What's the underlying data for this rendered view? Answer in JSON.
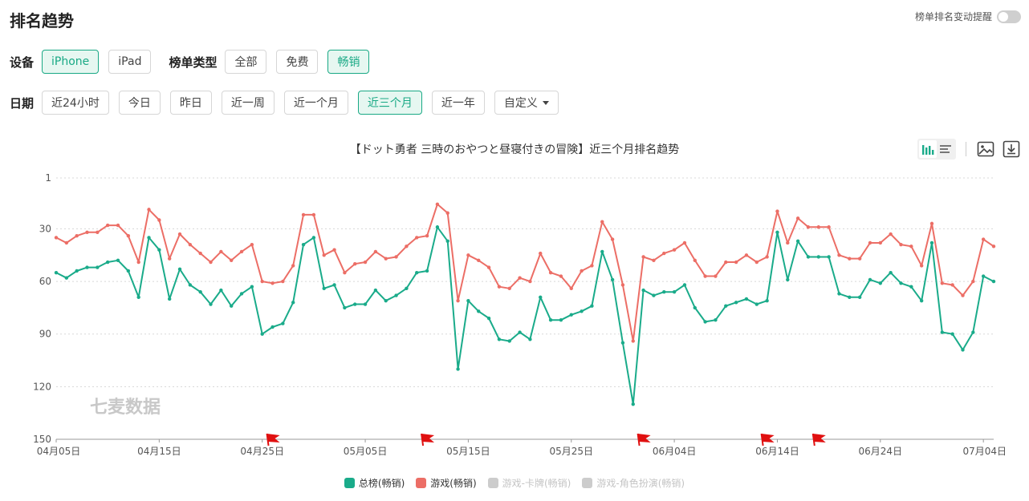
{
  "header": {
    "title": "排名趋势",
    "toggle_label": "榜单排名变动提醒"
  },
  "filters": {
    "device_label": "设备",
    "devices": [
      {
        "label": "iPhone",
        "active": true
      },
      {
        "label": "iPad",
        "active": false
      }
    ],
    "list_type_label": "榜单类型",
    "list_types": [
      {
        "label": "全部",
        "active": false
      },
      {
        "label": "免费",
        "active": false
      },
      {
        "label": "畅销",
        "active": true
      }
    ],
    "date_label": "日期",
    "dates": [
      {
        "label": "近24小时",
        "active": false
      },
      {
        "label": "今日",
        "active": false
      },
      {
        "label": "昨日",
        "active": false
      },
      {
        "label": "近一周",
        "active": false
      },
      {
        "label": "近一个月",
        "active": false
      },
      {
        "label": "近三个月",
        "active": true
      },
      {
        "label": "近一年",
        "active": false
      },
      {
        "label": "自定义",
        "active": false,
        "dropdown": true
      }
    ]
  },
  "colors": {
    "accent": "#19a985",
    "series_green": "#1aab8a",
    "series_red": "#ec6e66",
    "series_disabled": "#cccccc",
    "flag": "#e01010"
  },
  "chart_data": {
    "type": "line",
    "title": "【ドット勇者 三時のおやつと昼寝付きの冒険】近三个月排名趋势",
    "x_start": "2025-04-05",
    "x_ticks": [
      "04月05日",
      "04月15日",
      "04月25日",
      "05月05日",
      "05月15日",
      "05月25日",
      "06月04日",
      "06月14日",
      "06月24日",
      "07月04日"
    ],
    "y_ticks": [
      1,
      30,
      60,
      90,
      120,
      150
    ],
    "ylim": [
      1,
      150
    ],
    "y_inverted": true,
    "grid": true,
    "watermark": "七麦数据",
    "flag_days": [
      21,
      36,
      57,
      69,
      74
    ],
    "legend_position": "bottom",
    "series": [
      {
        "name": "总榜(畅销)",
        "color": "#1aab8a",
        "enabled": true,
        "values": [
          55,
          58,
          54,
          52,
          52,
          49,
          48,
          54,
          69,
          35,
          42,
          70,
          53,
          62,
          66,
          73,
          65,
          74,
          67,
          63,
          90,
          86,
          84,
          72,
          39,
          35,
          64,
          62,
          75,
          73,
          73,
          65,
          71,
          68,
          64,
          55,
          54,
          29,
          37,
          110,
          71,
          77,
          81,
          93,
          94,
          89,
          93,
          69,
          82,
          82,
          79,
          77,
          74,
          43,
          59,
          95,
          130,
          65,
          68,
          66,
          66,
          62,
          75,
          83,
          82,
          74,
          72,
          70,
          73,
          71,
          32,
          59,
          37,
          46,
          46,
          46,
          67,
          69,
          69,
          59,
          61,
          55,
          61,
          63,
          71,
          38,
          89,
          90,
          99,
          89,
          57,
          60
        ]
      },
      {
        "name": "游戏(畅销)",
        "color": "#ec6e66",
        "enabled": true,
        "values": [
          35,
          38,
          34,
          32,
          32,
          28,
          28,
          34,
          49,
          19,
          25,
          47,
          33,
          39,
          44,
          49,
          43,
          48,
          43,
          39,
          60,
          61,
          60,
          51,
          22,
          22,
          45,
          42,
          55,
          50,
          49,
          43,
          47,
          46,
          40,
          35,
          34,
          16,
          21,
          71,
          45,
          48,
          52,
          63,
          64,
          58,
          60,
          44,
          55,
          57,
          64,
          54,
          51,
          26,
          36,
          62,
          94,
          46,
          48,
          44,
          42,
          38,
          48,
          57,
          57,
          49,
          49,
          45,
          49,
          46,
          20,
          38,
          24,
          29,
          29,
          29,
          45,
          47,
          47,
          38,
          38,
          33,
          39,
          40,
          51,
          27,
          61,
          62,
          68,
          60,
          36,
          40
        ]
      },
      {
        "name": "游戏-卡牌(畅销)",
        "color": "#cccccc",
        "enabled": false,
        "values": []
      },
      {
        "name": "游戏-角色扮演(畅销)",
        "color": "#cccccc",
        "enabled": false,
        "values": []
      }
    ]
  }
}
